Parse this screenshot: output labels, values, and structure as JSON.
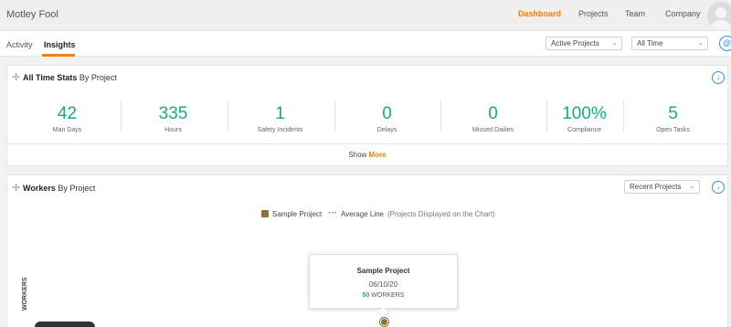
{
  "topbar": {
    "brand": "Motley Fool",
    "nav": [
      {
        "label": "Dashboard",
        "active": true
      },
      {
        "label": "Projects",
        "active": false
      },
      {
        "label": "Team",
        "active": false
      },
      {
        "label": "Company",
        "active": false
      }
    ]
  },
  "subbar": {
    "tabs": [
      {
        "label": "Activity",
        "active": false
      },
      {
        "label": "Insights",
        "active": true
      }
    ],
    "project_filter": "Active Projects",
    "time_filter": "All Time"
  },
  "stats_panel": {
    "title_bold": "All Time Stats",
    "title_rest": " By Project",
    "stats": [
      {
        "value": "42",
        "label": "Man Days"
      },
      {
        "value": "335",
        "label": "Hours"
      },
      {
        "value": "1",
        "label": "Safety Incidents"
      },
      {
        "value": "0",
        "label": "Delays"
      },
      {
        "value": "0",
        "label": "Missed Dailies"
      },
      {
        "value": "100%",
        "label": "Compliance"
      },
      {
        "value": "5",
        "label": "Open Tasks"
      }
    ],
    "show_label": "Show ",
    "more_label": "More"
  },
  "workers_panel": {
    "title_bold": "Workers",
    "title_rest": " By Project",
    "filter": "Recent Projects",
    "legend": {
      "series_name": "Sample Project",
      "average_label": "Average Line",
      "note": "(Projects Displayed on the Chart)"
    },
    "y_axis_label": "WORKERS",
    "tooltip": {
      "title": "Sample Project",
      "date": "06/10/20",
      "workers_value": "50",
      "workers_unit": " WORKERS"
    }
  },
  "chart_data": {
    "type": "line",
    "series": [
      {
        "name": "Sample Project",
        "points": [
          {
            "x": "06/10/20",
            "y": 50
          }
        ],
        "color": "#8b7137"
      }
    ],
    "ylabel": "WORKERS"
  },
  "colors": {
    "accent": "#e8850b",
    "stat_green": "#19a883",
    "link_blue": "#3b8fd9",
    "series_brown": "#8b7137"
  },
  "icons": {
    "drag": "drag-handle-icon",
    "download": "download-icon",
    "help": "help-circle-icon",
    "chevron": "chevron-down-icon"
  }
}
